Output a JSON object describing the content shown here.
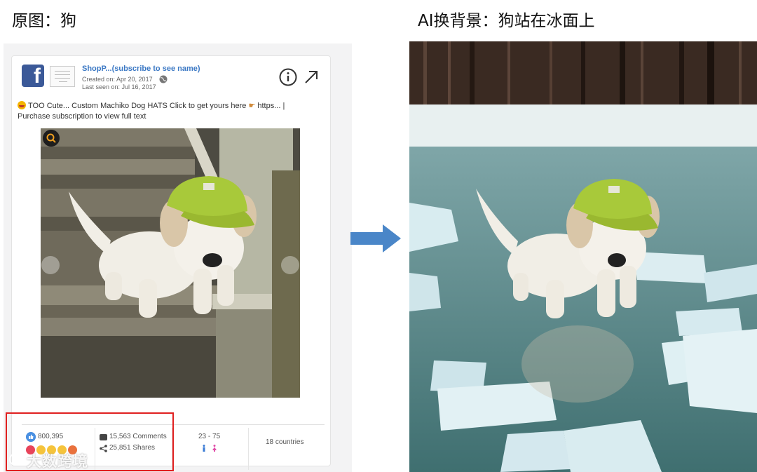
{
  "captions": {
    "left": "原图：狗",
    "right": "AI换背景：狗站在冰面上"
  },
  "ad": {
    "page_name": "ShopP...(subscribe to see name)",
    "created": "Created on: Apr 20, 2017",
    "last_seen": "Last seen on: Jul 16, 2017",
    "text_line1": "TOO Cute... Custom Machiko Dog HATS Click to get yours here",
    "text_link": "https...",
    "text_sep": "|",
    "text_line2": "Purchase subscription to view full text"
  },
  "stats": {
    "likes": "800,395",
    "comments": "15,563 Comments",
    "shares": "25,851 Shares",
    "age_range": "23 - 75",
    "countries": "18 countries"
  },
  "watermark": "大数跨境",
  "colors": {
    "facebook_blue": "#3b5998",
    "link_blue": "#3b78c4",
    "highlight_red": "#e02020",
    "arrow_blue": "#4a86c8",
    "hat_green": "#a8c93a"
  },
  "icons": [
    "facebook-logo-icon",
    "globe-icon",
    "info-icon",
    "external-link-icon",
    "zoom-icon",
    "like-icon",
    "comment-icon",
    "share-icon",
    "male-icon",
    "female-icon",
    "arrow-right-icon"
  ]
}
